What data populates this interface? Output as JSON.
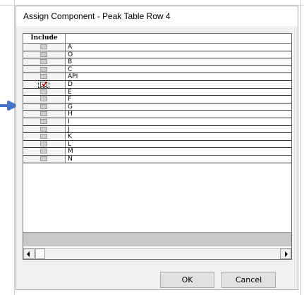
{
  "dialog": {
    "title": "Assign Component - Peak Table Row 4"
  },
  "grid": {
    "header": {
      "include": "Include",
      "name": ""
    },
    "rows": [
      {
        "name": "A",
        "checked": false
      },
      {
        "name": "O",
        "checked": false
      },
      {
        "name": "B",
        "checked": false
      },
      {
        "name": "C",
        "checked": false
      },
      {
        "name": "API",
        "checked": false
      },
      {
        "name": "D",
        "checked": true
      },
      {
        "name": "E",
        "checked": false
      },
      {
        "name": "F",
        "checked": false
      },
      {
        "name": "G",
        "checked": false
      },
      {
        "name": "H",
        "checked": false
      },
      {
        "name": "I",
        "checked": false
      },
      {
        "name": "J",
        "checked": false
      },
      {
        "name": "K",
        "checked": false
      },
      {
        "name": "L",
        "checked": false
      },
      {
        "name": "M",
        "checked": false
      },
      {
        "name": "N",
        "checked": false
      }
    ]
  },
  "buttons": {
    "ok": "OK",
    "cancel": "Cancel"
  },
  "colors": {
    "arrow": "#4472c4",
    "checkmark": "#cc0000"
  }
}
